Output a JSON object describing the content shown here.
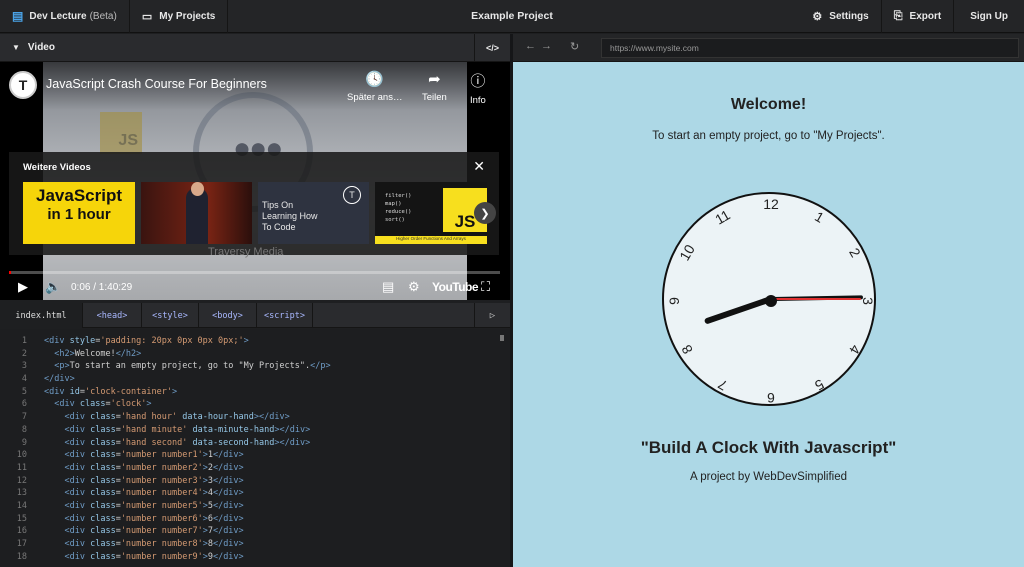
{
  "topbar": {
    "app_name": "Dev Lecture",
    "beta": "(Beta)",
    "my_projects": "My Projects",
    "project_title": "Example Project",
    "settings": "Settings",
    "export": "Export",
    "sign_up": "Sign Up"
  },
  "video_panel": {
    "header": "Video",
    "code_toggle": "</>",
    "title": "JavaScript Crash Course For Beginners",
    "channel_initial": "T",
    "actions": {
      "watch_later": "Später ans…",
      "share": "Teilen",
      "info": "Info"
    },
    "more_videos": {
      "title": "Weitere Videos",
      "thumb1_line1": "JavaScript",
      "thumb1_line2": "in 1 hour",
      "thumb3_text": "Tips On\nLearning How\nTo Code",
      "thumb3_logo": "T",
      "thumb4_code": "filter()\nmap()\nreduce()\nsort()",
      "thumb4_badge": "JS",
      "thumb4_strip": "Higher Order Functions And Arrays"
    },
    "ghost_caption": "Traversy Media",
    "time": "0:06 / 1:40:29",
    "player_brand": "YouTube",
    "progress_fraction": 0.001
  },
  "editor": {
    "tabs": [
      "index.html",
      "<head>",
      "<style>",
      "<body>",
      "<script>"
    ],
    "active_tab": 0,
    "lines": [
      {
        "n": "1",
        "html": "<span class='t'>&lt;div</span> <span class='a'>style</span><span class='x'>=</span><span class='s'>'padding: 20px 0px 0px 0px;'</span><span class='t'>&gt;</span>"
      },
      {
        "n": "2",
        "html": "  <span class='t'>&lt;h2&gt;</span><span class='x'>Welcome!</span><span class='t'>&lt;/h2&gt;</span>"
      },
      {
        "n": "3",
        "html": "  <span class='t'>&lt;p&gt;</span><span class='x'>To start an empty project, go to \"My Projects\".</span><span class='t'>&lt;/p&gt;</span>"
      },
      {
        "n": "4",
        "html": "<span class='t'>&lt;/div&gt;</span>"
      },
      {
        "n": "5",
        "html": "<span class='t'>&lt;div</span> <span class='a'>id</span><span class='x'>=</span><span class='s'>'clock-container'</span><span class='t'>&gt;</span>"
      },
      {
        "n": "6",
        "html": "  <span class='t'>&lt;div</span> <span class='a'>class</span><span class='x'>=</span><span class='s'>'clock'</span><span class='t'>&gt;</span>"
      },
      {
        "n": "7",
        "html": "    <span class='t'>&lt;div</span> <span class='a'>class</span><span class='x'>=</span><span class='s'>'hand hour'</span> <span class='a'>data-hour-hand</span><span class='t'>&gt;&lt;/div&gt;</span>"
      },
      {
        "n": "8",
        "html": "    <span class='t'>&lt;div</span> <span class='a'>class</span><span class='x'>=</span><span class='s'>'hand minute'</span> <span class='a'>data-minute-hand</span><span class='t'>&gt;&lt;/div&gt;</span>"
      },
      {
        "n": "9",
        "html": "    <span class='t'>&lt;div</span> <span class='a'>class</span><span class='x'>=</span><span class='s'>'hand second'</span> <span class='a'>data-second-hand</span><span class='t'>&gt;&lt;/div&gt;</span>"
      },
      {
        "n": "10",
        "html": "    <span class='t'>&lt;div</span> <span class='a'>class</span><span class='x'>=</span><span class='s'>'number number1'</span><span class='t'>&gt;</span><span class='x'>1</span><span class='t'>&lt;/div&gt;</span>"
      },
      {
        "n": "11",
        "html": "    <span class='t'>&lt;div</span> <span class='a'>class</span><span class='x'>=</span><span class='s'>'number number2'</span><span class='t'>&gt;</span><span class='x'>2</span><span class='t'>&lt;/div&gt;</span>"
      },
      {
        "n": "12",
        "html": "    <span class='t'>&lt;div</span> <span class='a'>class</span><span class='x'>=</span><span class='s'>'number number3'</span><span class='t'>&gt;</span><span class='x'>3</span><span class='t'>&lt;/div&gt;</span>"
      },
      {
        "n": "13",
        "html": "    <span class='t'>&lt;div</span> <span class='a'>class</span><span class='x'>=</span><span class='s'>'number number4'</span><span class='t'>&gt;</span><span class='x'>4</span><span class='t'>&lt;/div&gt;</span>"
      },
      {
        "n": "14",
        "html": "    <span class='t'>&lt;div</span> <span class='a'>class</span><span class='x'>=</span><span class='s'>'number number5'</span><span class='t'>&gt;</span><span class='x'>5</span><span class='t'>&lt;/div&gt;</span>"
      },
      {
        "n": "15",
        "html": "    <span class='t'>&lt;div</span> <span class='a'>class</span><span class='x'>=</span><span class='s'>'number number6'</span><span class='t'>&gt;</span><span class='x'>6</span><span class='t'>&lt;/div&gt;</span>"
      },
      {
        "n": "16",
        "html": "    <span class='t'>&lt;div</span> <span class='a'>class</span><span class='x'>=</span><span class='s'>'number number7'</span><span class='t'>&gt;</span><span class='x'>7</span><span class='t'>&lt;/div&gt;</span>"
      },
      {
        "n": "17",
        "html": "    <span class='t'>&lt;div</span> <span class='a'>class</span><span class='x'>=</span><span class='s'>'number number8'</span><span class='t'>&gt;</span><span class='x'>8</span><span class='t'>&lt;/div&gt;</span>"
      },
      {
        "n": "18",
        "html": "    <span class='t'>&lt;div</span> <span class='a'>class</span><span class='x'>=</span><span class='s'>'number number9'</span><span class='t'>&gt;</span><span class='x'>9</span><span class='t'>&lt;/div&gt;</span>"
      }
    ]
  },
  "browser": {
    "url": "https://www.mysite.com"
  },
  "preview": {
    "heading": "Welcome!",
    "paragraph": "To start an empty project, go to \"My Projects\".",
    "clock_numbers": [
      "1",
      "2",
      "3",
      "4",
      "5",
      "6",
      "7",
      "8",
      "9",
      "10",
      "11",
      "12"
    ],
    "title": "\"Build A Clock With Javascript\"",
    "byline": "A project by WebDevSimplified"
  },
  "colors": {
    "accent": "#4aa3e8",
    "preview_bg": "#add8e6",
    "clock_face": "#ecf3f6",
    "second_hand": "#e03030"
  }
}
